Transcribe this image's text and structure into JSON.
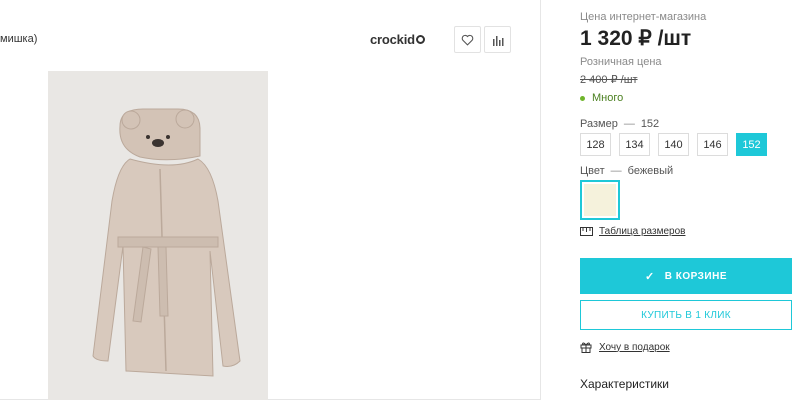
{
  "product": {
    "breadcrumb_fragment": "мишка)",
    "brand": "crockid"
  },
  "price_block": {
    "shop_price_label": "Цена интернет-магазина",
    "shop_price": "1 320 ₽ /шт",
    "retail_label": "Розничная цена",
    "retail_price": "2 400 ₽ /шт",
    "stock": "Много"
  },
  "size_selector": {
    "label": "Размер",
    "dash": "—",
    "selected": "152",
    "options": [
      "128",
      "134",
      "140",
      "146",
      "152"
    ]
  },
  "color_selector": {
    "label": "Цвет",
    "dash": "—",
    "selected": "бежевый",
    "swatch_color": "#f5f2dc"
  },
  "links": {
    "size_table": "Таблица размеров",
    "gift": "Хочу в подарок"
  },
  "buttons": {
    "in_cart": "В КОРЗИНЕ",
    "one_click": "КУПИТЬ В 1 КЛИК"
  },
  "section": {
    "characteristics": "Характеристики"
  },
  "colors": {
    "accent": "#1ec8d8",
    "stock_green": "#6fb52c"
  },
  "icons": [
    "heart-icon",
    "compare-chart-icon",
    "ruler-icon",
    "gift-icon",
    "check-icon"
  ]
}
